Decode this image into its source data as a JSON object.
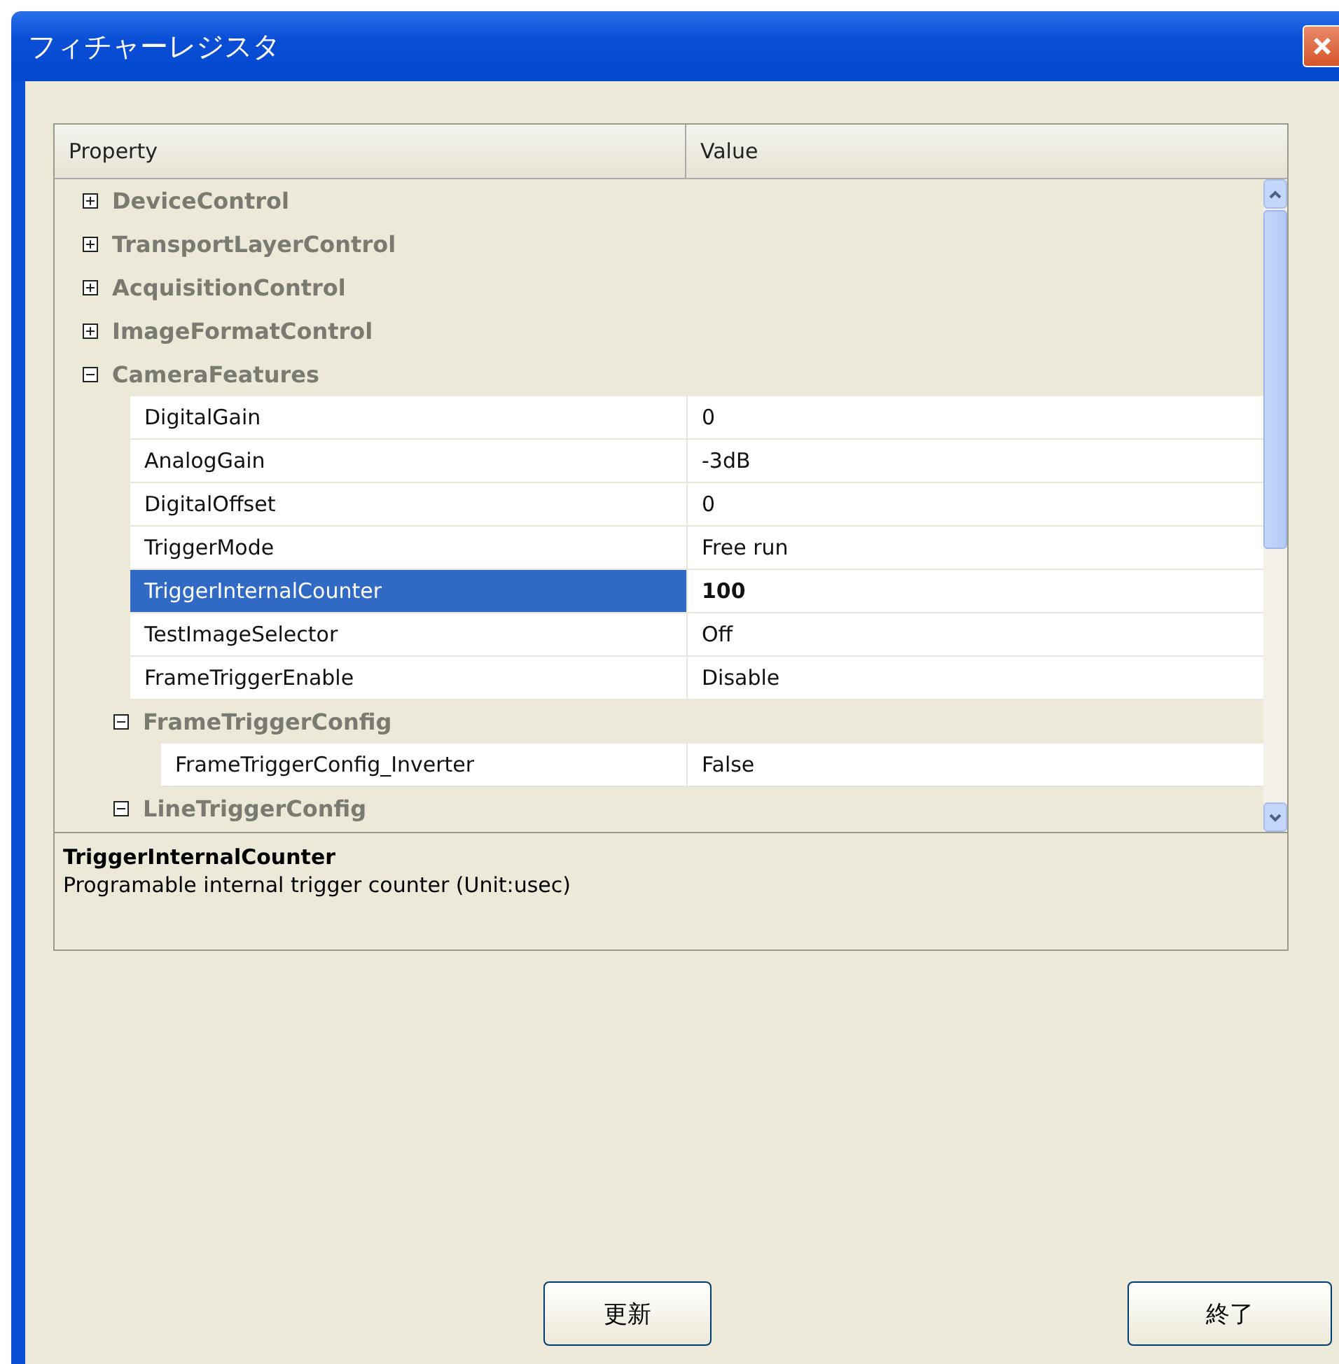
{
  "window": {
    "title": "フィチャーレジスタ"
  },
  "grid": {
    "columns": [
      "Property",
      "Value"
    ],
    "items": [
      {
        "kind": "category",
        "name": "DeviceControl",
        "expanded": false
      },
      {
        "kind": "category",
        "name": "TransportLayerControl",
        "expanded": false
      },
      {
        "kind": "category",
        "name": "AcquisitionControl",
        "expanded": false
      },
      {
        "kind": "category",
        "name": "ImageFormatControl",
        "expanded": false
      },
      {
        "kind": "category",
        "name": "CameraFeatures",
        "expanded": true,
        "children": [
          {
            "kind": "property",
            "name": "DigitalGain",
            "value": "0",
            "selected": false,
            "modified": false
          },
          {
            "kind": "property",
            "name": "AnalogGain",
            "value": "-3dB",
            "selected": false,
            "modified": false
          },
          {
            "kind": "property",
            "name": "DigitalOffset",
            "value": "0",
            "selected": false,
            "modified": false
          },
          {
            "kind": "property",
            "name": "TriggerMode",
            "value": "Free run",
            "selected": false,
            "modified": false
          },
          {
            "kind": "property",
            "name": "TriggerInternalCounter",
            "value": "100",
            "selected": true,
            "modified": true
          },
          {
            "kind": "property",
            "name": "TestImageSelector",
            "value": "Off",
            "selected": false,
            "modified": false
          },
          {
            "kind": "property",
            "name": "FrameTriggerEnable",
            "value": "Disable",
            "selected": false,
            "modified": false
          },
          {
            "kind": "category",
            "name": "FrameTriggerConfig",
            "expanded": true,
            "children": [
              {
                "kind": "property",
                "name": "FrameTriggerConfig_Inverter",
                "value": "False",
                "selected": false,
                "modified": false
              }
            ]
          },
          {
            "kind": "category",
            "name": "LineTriggerConfig",
            "expanded": true
          }
        ]
      }
    ]
  },
  "help": {
    "title": "TriggerInternalCounter",
    "text": "Programable internal trigger counter (Unit:usec)"
  },
  "buttons": [
    "更新",
    "終了"
  ]
}
